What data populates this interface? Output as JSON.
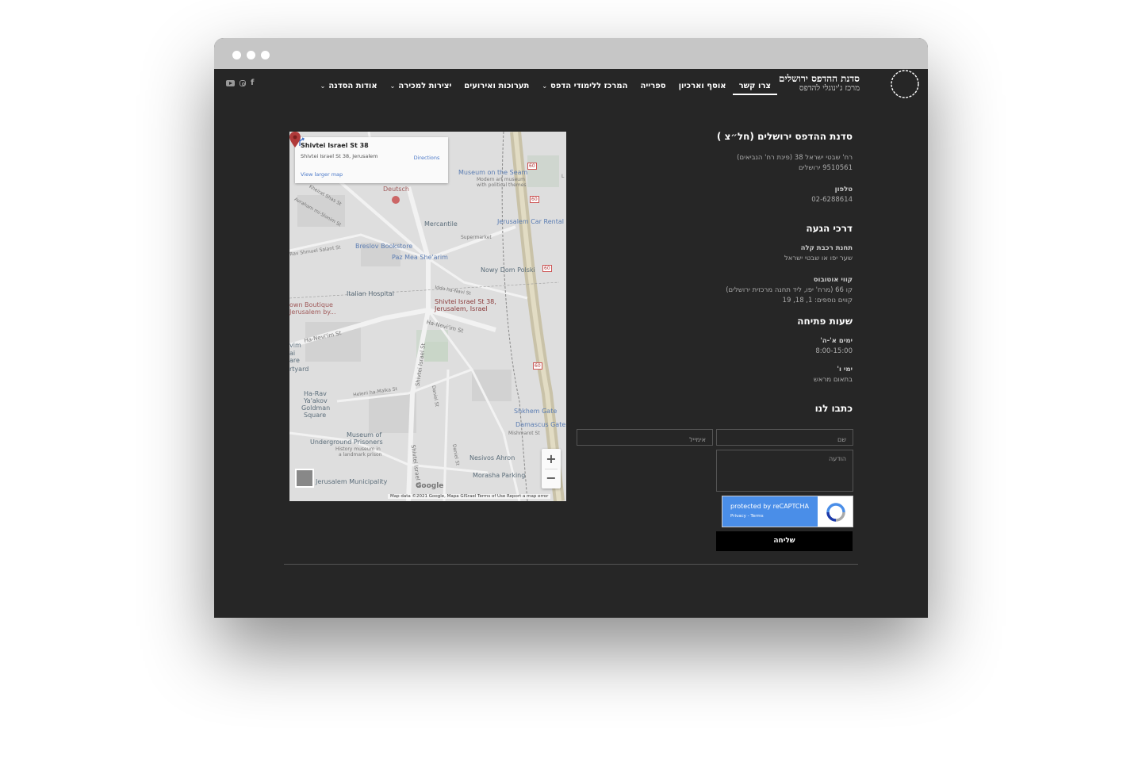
{
  "header": {
    "brand_title": "סדנת ההדפס ירושלים",
    "brand_subtitle": "מרכז ג'ינוגלי להדפס",
    "nav": [
      {
        "label": "אודות הסדנה",
        "dropdown": true
      },
      {
        "label": "יצירות למכירה",
        "dropdown": true
      },
      {
        "label": "תערוכות ואירועים",
        "dropdown": false
      },
      {
        "label": "המרכז ללימודי הדפס",
        "dropdown": true
      },
      {
        "label": "ספרייה",
        "dropdown": false
      },
      {
        "label": "אוסף וארכיון",
        "dropdown": false
      },
      {
        "label": "צרו קשר",
        "dropdown": false,
        "active": true
      }
    ],
    "social_icons": [
      "facebook-icon",
      "instagram-icon",
      "youtube-icon"
    ]
  },
  "map": {
    "info_title": "Shivtei Israel St 38",
    "info_address": "Shivtei Israel St 38, Jerusalem",
    "view_larger": "View larger map",
    "directions": "Directions",
    "pin_label_1": "Shivtei Israel St 38,",
    "pin_label_2": "Jerusalem, Israel",
    "labels": {
      "museum_seam": "Museum on the Seam",
      "museum_seam_sub1": "Modern art museum",
      "museum_seam_sub2": "with political themes",
      "deutsch": "Deutsch",
      "mercantile": "Mercantile",
      "supermarket": "Supermarket",
      "car_rental": "Jerusalem Car Rental",
      "breslov": "Breslov Bookstore",
      "paz": "Paz Mea She'arim",
      "nowy": "Nowy Dom Polski",
      "hospital": "Italian Hospital",
      "boutique1": "own Boutique",
      "boutique2": "Jerusalem by...",
      "haneviim": "Ha-Nevi'im St",
      "haneviim2": "Ha-Nevi'im St",
      "shkhem": "Shkhem Gate",
      "damascus": "Damascus Gate",
      "mishmarot": "Mishmarot St",
      "underground1": "Museum of",
      "underground2": "Underground Prisoners",
      "underground3": "History museum in",
      "underground4": "a landmark prison",
      "goldman1": "Ha-Rav",
      "goldman2": "Ya'akov",
      "goldman3": "Goldman",
      "goldman4": "Square",
      "nesivos": "Nesivos Ahron",
      "morasha": "Morasha Parking",
      "municipality": "Jerusalem Municipality",
      "shivtei": "Shivtei Israel St",
      "shivtei2": "Shivtei Israel St",
      "daniel": "Daniel St",
      "daniel2": "Daniel St",
      "heleni": "Heleni ha-Malka St",
      "rav_shmuel": "Rav Shmuel Salant St",
      "avraham": "Avraham mi-Slonim St",
      "kheirat": "Kheirat Shas St",
      "idi": "Iddo ha-Navi St",
      "arta": "rtyard",
      "vim": "vim",
      "ai": "ai",
      "are": "are",
      "road60_1": "60",
      "road60_2": "60",
      "road60_3": "60",
      "road60_4": "60",
      "rd_l": "L"
    },
    "google": "Google",
    "footer": "Map data ©2021 Google, Mapa GISrael    Terms of Use    Report a map error",
    "zoom_in": "+",
    "zoom_out": "−"
  },
  "info": {
    "org_title": "סדנת ההדפס ירושלים (חל״צ )",
    "address_line1": "רח' שבטי ישראל 38 (פינת רח' הנביאים)",
    "address_line2": "9510561 ירושלים",
    "phone_label": "טלפון",
    "phone": "02-6288614",
    "directions_title": "דרכי הגעה",
    "lightrail_label": "תחנת רכבת קלה",
    "lightrail_value": "שער יפו או שבטי ישראל",
    "bus_label": "קווי אוטובוס",
    "bus_value1": "קו 66 (מרח' יפו, ליד תחנה מרכזית ירושלים)",
    "bus_value2": "קווים נוספים: 1, 18, 19",
    "hours_title": "שעות פתיחה",
    "days1_label": "ימים א'-ה'",
    "days1_value": "8:00-15:00",
    "days2_label": "ימי ו'",
    "days2_value": "בתאום מראש",
    "contact_title": "כתבו לנו"
  },
  "form": {
    "name_placeholder": "שם",
    "email_placeholder": "אימייל",
    "message_placeholder": "הודעה",
    "recaptcha_text": "protected by reCAPTCHA",
    "recaptcha_links": "Privacy - Terms",
    "submit_label": "שליחה"
  }
}
